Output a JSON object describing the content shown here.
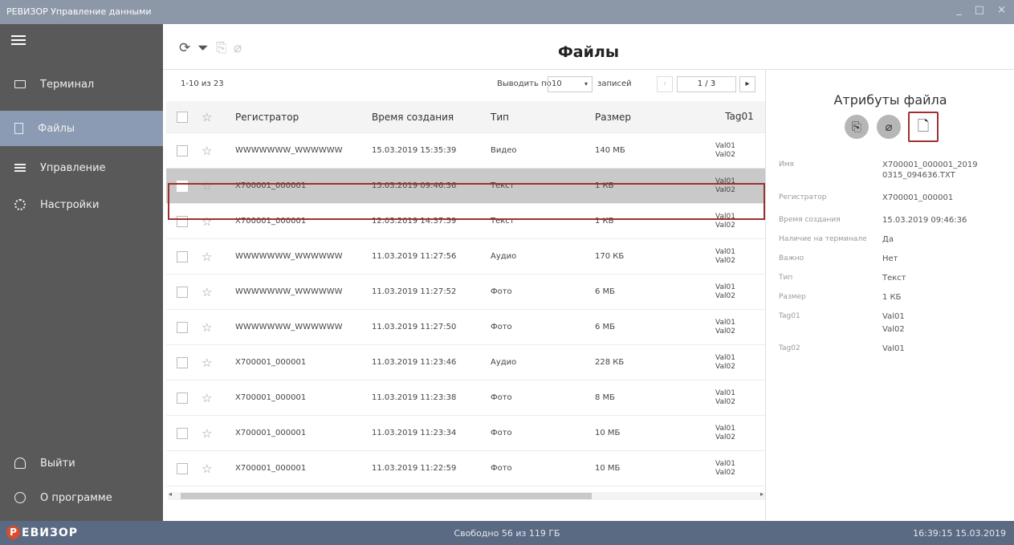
{
  "window": {
    "title": "РЕВИЗОР Управление данными",
    "controls": [
      "_",
      "□",
      "×"
    ]
  },
  "sidebar": {
    "items": [
      {
        "label": "Терминал",
        "icon": "terminal-icon"
      },
      {
        "label": "Файлы",
        "icon": "files-icon",
        "active": true
      },
      {
        "label": "Управление",
        "icon": "control-icon"
      },
      {
        "label": "Настройки",
        "icon": "settings-icon"
      }
    ],
    "bottom": [
      {
        "label": "Выйти",
        "icon": "user-icon"
      },
      {
        "label": "О программе",
        "icon": "info-icon"
      }
    ]
  },
  "toolbar": {
    "refresh_icon": "⟳",
    "filter_icon": "⏷",
    "copy_icon": "⎘",
    "erase_icon": "⌀"
  },
  "page": {
    "title": "Файлы"
  },
  "pager": {
    "count": "1-10 из 23",
    "show_label": "Выводить по",
    "per_page": "10",
    "records_label": "записей",
    "prev": "‹",
    "page": "1 / 3",
    "next": "▸"
  },
  "table": {
    "headers": {
      "reg": "Регистратор",
      "time": "Время создания",
      "type": "Тип",
      "size": "Размер",
      "tag": "Tag01"
    },
    "rows": [
      {
        "reg": "WWWWWWW_WWWWWW",
        "time": "15.03.2019 15:35:39",
        "type": "Видео",
        "size": "140 МБ",
        "tag1": "Val01",
        "tag2": "Val02"
      },
      {
        "reg": "X700001_000001",
        "time": "15.03.2019 09:46:36",
        "type": "Текст",
        "size": "1 КБ",
        "tag1": "Val01",
        "tag2": "Val02",
        "selected": true
      },
      {
        "reg": "X700001_000001",
        "time": "12.03.2019 14:37:59",
        "type": "Текст",
        "size": "1 КБ",
        "tag1": "Val01",
        "tag2": "Val02"
      },
      {
        "reg": "WWWWWWW_WWWWWW",
        "time": "11.03.2019 11:27:56",
        "type": "Аудио",
        "size": "170 КБ",
        "tag1": "Val01",
        "tag2": "Val02"
      },
      {
        "reg": "WWWWWWW_WWWWWW",
        "time": "11.03.2019 11:27:52",
        "type": "Фото",
        "size": "6 МБ",
        "tag1": "Val01",
        "tag2": "Val02"
      },
      {
        "reg": "WWWWWWW_WWWWWW",
        "time": "11.03.2019 11:27:50",
        "type": "Фото",
        "size": "6 МБ",
        "tag1": "Val01",
        "tag2": "Val02"
      },
      {
        "reg": "X700001_000001",
        "time": "11.03.2019 11:23:46",
        "type": "Аудио",
        "size": "228 КБ",
        "tag1": "Val01",
        "tag2": "Val02"
      },
      {
        "reg": "X700001_000001",
        "time": "11.03.2019 11:23:38",
        "type": "Фото",
        "size": "8 МБ",
        "tag1": "Val01",
        "tag2": "Val02"
      },
      {
        "reg": "X700001_000001",
        "time": "11.03.2019 11:23:34",
        "type": "Фото",
        "size": "10 МБ",
        "tag1": "Val01",
        "tag2": "Val02"
      },
      {
        "reg": "X700001_000001",
        "time": "11.03.2019 11:22:59",
        "type": "Фото",
        "size": "10 МБ",
        "tag1": "Val01",
        "tag2": "Val02"
      }
    ]
  },
  "attributes": {
    "title": "Атрибуты файла",
    "fields": [
      {
        "label": "Имя",
        "value": "X700001_000001_2019 0315_094636.TXT"
      },
      {
        "label": "Регистратор",
        "value": "X700001_000001"
      },
      {
        "label": "Время создания",
        "value": "15.03.2019 09:46:36"
      },
      {
        "label": "Наличие на терминале",
        "value": "Да"
      },
      {
        "label": "Важно",
        "value": "Нет"
      },
      {
        "label": "Тип",
        "value": "Текст"
      },
      {
        "label": "Размер",
        "value": "1 КБ"
      },
      {
        "label": "Tag01",
        "value": "Val01"
      },
      {
        "label": "",
        "value": "Val02"
      },
      {
        "label": "Tag02",
        "value": "Val01"
      }
    ]
  },
  "status": {
    "logo_mark": "Р",
    "logo_text": "ЕВИЗОР",
    "free": "Свободно 56 из 119 ГБ",
    "clock": "16:39:15 15.03.2019"
  }
}
